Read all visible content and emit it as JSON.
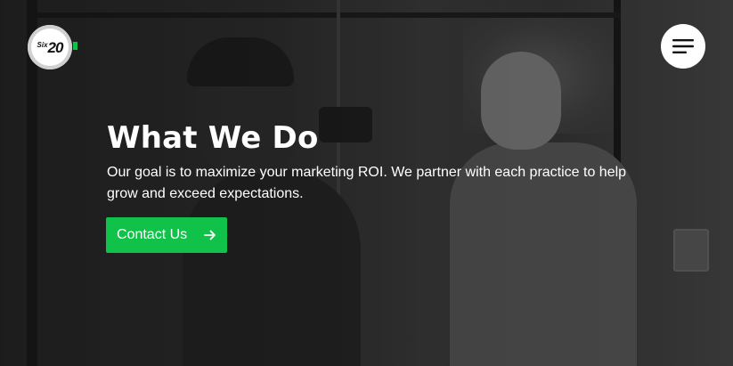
{
  "logo": {
    "prefix": "Six",
    "number": "20",
    "accent_color": "#10c24a"
  },
  "menu": {
    "icon": "hamburger-menu-icon"
  },
  "hero": {
    "title": "What We Do",
    "subtitle": "Our goal is to maximize your marketing ROI. We partner with each practice to help grow and exceed expectations.",
    "cta_label": "Contact Us",
    "cta_icon": "arrow-right-icon",
    "cta_color": "#10c24a",
    "text_color": "#ffffff"
  }
}
